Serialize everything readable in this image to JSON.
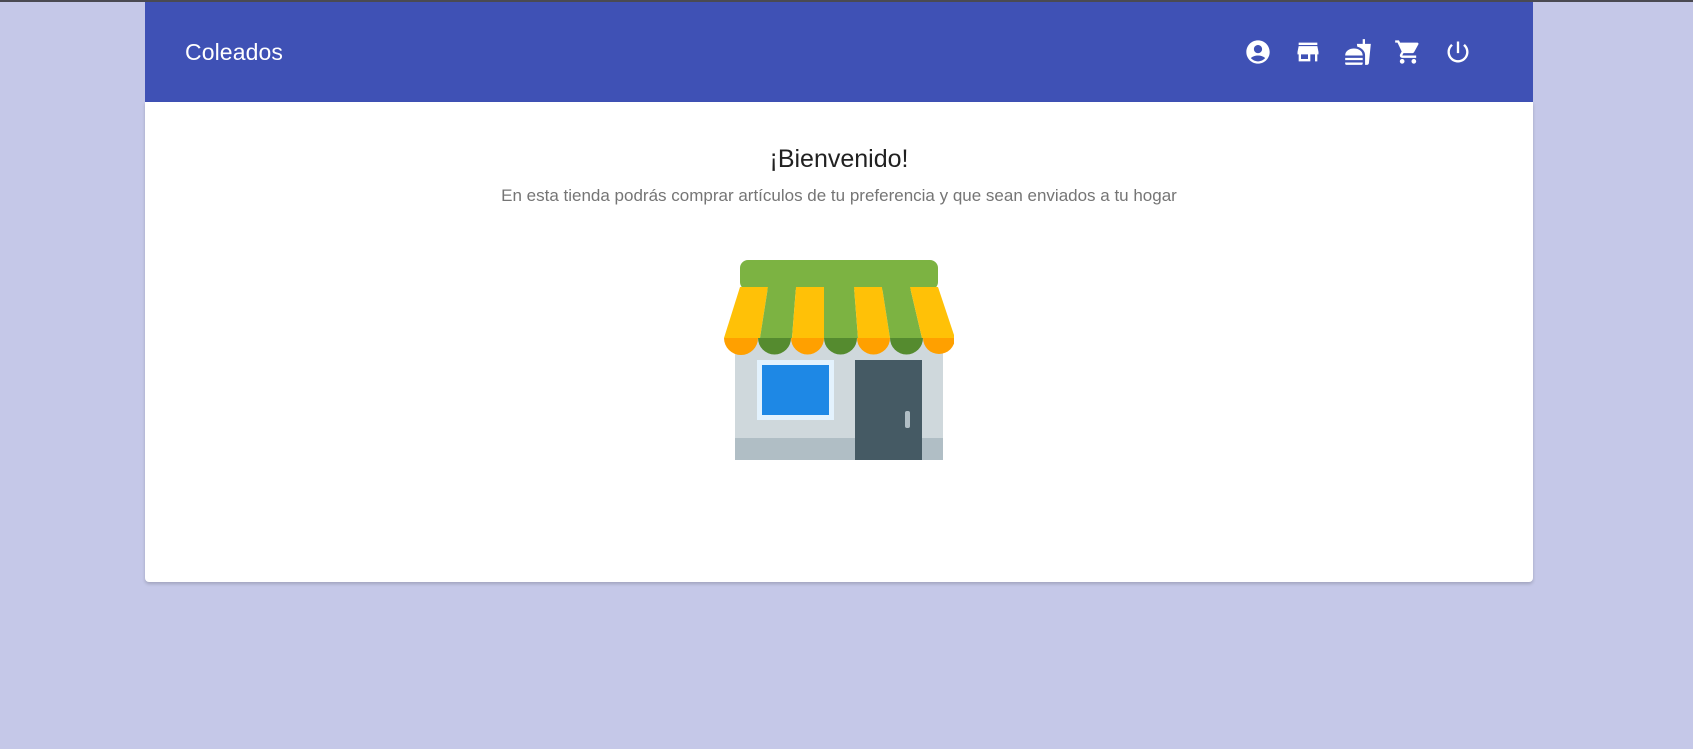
{
  "header": {
    "brand": "Coleados",
    "nav": [
      {
        "icon": "account-circle-icon",
        "name": "account"
      },
      {
        "icon": "store-icon",
        "name": "store"
      },
      {
        "icon": "fastfood-icon",
        "name": "food"
      },
      {
        "icon": "shopping-cart-icon",
        "name": "cart"
      },
      {
        "icon": "power-icon",
        "name": "logout"
      }
    ]
  },
  "main": {
    "title": "¡Bienvenido!",
    "subtitle": "En esta tienda podrás comprar artículos de tu preferencia y que sean enviados a tu hogar",
    "illustration": "storefront-illustration"
  },
  "colors": {
    "background": "#c5c8e8",
    "primary": "#3f51b5",
    "awning_green": "#7cb342",
    "awning_yellow": "#ffc107"
  }
}
